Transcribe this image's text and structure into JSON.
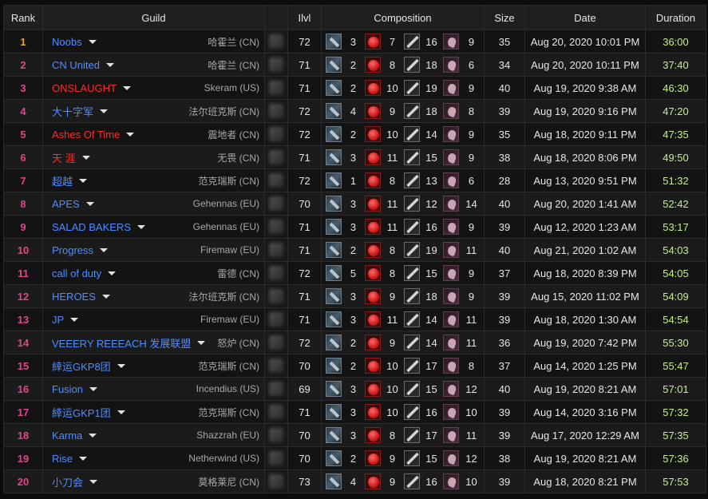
{
  "headers": {
    "rank": "Rank",
    "guild": "Guild",
    "ilvl": "Ilvl",
    "composition": "Composition",
    "size": "Size",
    "date": "Date",
    "duration": "Duration"
  },
  "colors": {
    "rank_gold": "#e8a436",
    "rank_pink": "#e0468a",
    "guild_alliance": "#4f8dff",
    "guild_horde": "#ff2a2a",
    "duration_green": "#c8ee8a"
  },
  "role_icons": {
    "tank": "tank-shield-icon",
    "healer": "healer-heart-icon",
    "melee": "melee-sword-icon",
    "ranged": "ranged-hand-icon"
  },
  "rows": [
    {
      "rank": "1",
      "guild": "Noobs",
      "faction": "alliance",
      "server": "哈霍兰 (CN)",
      "ilvl": "72",
      "tanks": "3",
      "healers": "7",
      "melee": "16",
      "ranged": "9",
      "size": "35",
      "date": "Aug 20, 2020 10:01 PM",
      "duration": "36:00"
    },
    {
      "rank": "2",
      "guild": "CN United",
      "faction": "alliance",
      "server": "哈霍兰 (CN)",
      "ilvl": "71",
      "tanks": "2",
      "healers": "8",
      "melee": "18",
      "ranged": "6",
      "size": "34",
      "date": "Aug 20, 2020 10:11 PM",
      "duration": "37:40"
    },
    {
      "rank": "3",
      "guild": "ONSLAUGHT",
      "faction": "horde",
      "server": "Skeram (US)",
      "ilvl": "71",
      "tanks": "2",
      "healers": "10",
      "melee": "19",
      "ranged": "9",
      "size": "40",
      "date": "Aug 19, 2020 9:38 AM",
      "duration": "46:30"
    },
    {
      "rank": "4",
      "guild": "大十字军",
      "faction": "alliance",
      "server": "法尔班克斯 (CN)",
      "ilvl": "72",
      "tanks": "4",
      "healers": "9",
      "melee": "18",
      "ranged": "8",
      "size": "39",
      "date": "Aug 19, 2020 9:16 PM",
      "duration": "47:20"
    },
    {
      "rank": "5",
      "guild": "Ashes Of Time",
      "faction": "horde",
      "server": "震地者 (CN)",
      "ilvl": "72",
      "tanks": "2",
      "healers": "10",
      "melee": "14",
      "ranged": "9",
      "size": "35",
      "date": "Aug 18, 2020 9:11 PM",
      "duration": "47:35"
    },
    {
      "rank": "6",
      "guild": "天 涯",
      "faction": "horde",
      "server": "无畏 (CN)",
      "ilvl": "71",
      "tanks": "3",
      "healers": "11",
      "melee": "15",
      "ranged": "9",
      "size": "38",
      "date": "Aug 18, 2020 8:06 PM",
      "duration": "49:50"
    },
    {
      "rank": "7",
      "guild": "超越",
      "faction": "alliance",
      "server": "范克瑞斯 (CN)",
      "ilvl": "72",
      "tanks": "1",
      "healers": "8",
      "melee": "13",
      "ranged": "6",
      "size": "28",
      "date": "Aug 13, 2020 9:51 PM",
      "duration": "51:32"
    },
    {
      "rank": "8",
      "guild": "APES",
      "faction": "alliance",
      "server": "Gehennas (EU)",
      "ilvl": "70",
      "tanks": "3",
      "healers": "11",
      "melee": "12",
      "ranged": "14",
      "size": "40",
      "date": "Aug 20, 2020 1:41 AM",
      "duration": "52:42"
    },
    {
      "rank": "9",
      "guild": "SALAD BAKERS",
      "faction": "alliance",
      "server": "Gehennas (EU)",
      "ilvl": "71",
      "tanks": "3",
      "healers": "11",
      "melee": "16",
      "ranged": "9",
      "size": "39",
      "date": "Aug 12, 2020 1:23 AM",
      "duration": "53:17"
    },
    {
      "rank": "10",
      "guild": "Progress",
      "faction": "alliance",
      "server": "Firemaw (EU)",
      "ilvl": "71",
      "tanks": "2",
      "healers": "8",
      "melee": "19",
      "ranged": "11",
      "size": "40",
      "date": "Aug 21, 2020 1:02 AM",
      "duration": "54:03"
    },
    {
      "rank": "11",
      "guild": "call of duty",
      "faction": "alliance",
      "server": "雷德 (CN)",
      "ilvl": "72",
      "tanks": "5",
      "healers": "8",
      "melee": "15",
      "ranged": "9",
      "size": "37",
      "date": "Aug 18, 2020 8:39 PM",
      "duration": "54:05"
    },
    {
      "rank": "12",
      "guild": "HEROES",
      "faction": "alliance",
      "server": "法尔班克斯 (CN)",
      "ilvl": "71",
      "tanks": "3",
      "healers": "9",
      "melee": "18",
      "ranged": "9",
      "size": "39",
      "date": "Aug 15, 2020 11:02 PM",
      "duration": "54:09"
    },
    {
      "rank": "13",
      "guild": "JP",
      "faction": "alliance",
      "server": "Firemaw (EU)",
      "ilvl": "71",
      "tanks": "3",
      "healers": "11",
      "melee": "14",
      "ranged": "11",
      "size": "39",
      "date": "Aug 18, 2020 1:30 AM",
      "duration": "54:54"
    },
    {
      "rank": "14",
      "guild": "VEEERY REEEACH 发展联盟",
      "faction": "alliance",
      "server": "怒炉 (CN)",
      "ilvl": "72",
      "tanks": "2",
      "healers": "9",
      "melee": "14",
      "ranged": "11",
      "size": "36",
      "date": "Aug 19, 2020 7:42 PM",
      "duration": "55:30"
    },
    {
      "rank": "15",
      "guild": "緈运GKP8团",
      "faction": "alliance",
      "server": "范克瑞斯 (CN)",
      "ilvl": "70",
      "tanks": "2",
      "healers": "10",
      "melee": "17",
      "ranged": "8",
      "size": "37",
      "date": "Aug 14, 2020 1:25 PM",
      "duration": "55:47"
    },
    {
      "rank": "16",
      "guild": "Fusion",
      "faction": "alliance",
      "server": "Incendius (US)",
      "ilvl": "69",
      "tanks": "3",
      "healers": "10",
      "melee": "15",
      "ranged": "12",
      "size": "40",
      "date": "Aug 19, 2020 8:21 AM",
      "duration": "57:01"
    },
    {
      "rank": "17",
      "guild": "緈运GKP1团",
      "faction": "alliance",
      "server": "范克瑞斯 (CN)",
      "ilvl": "71",
      "tanks": "3",
      "healers": "10",
      "melee": "16",
      "ranged": "10",
      "size": "39",
      "date": "Aug 14, 2020 3:16 PM",
      "duration": "57:32"
    },
    {
      "rank": "18",
      "guild": "Karma",
      "faction": "alliance",
      "server": "Shazzrah (EU)",
      "ilvl": "70",
      "tanks": "3",
      "healers": "8",
      "melee": "17",
      "ranged": "11",
      "size": "39",
      "date": "Aug 17, 2020 12:29 AM",
      "duration": "57:35"
    },
    {
      "rank": "19",
      "guild": "Rise",
      "faction": "alliance",
      "server": "Netherwind (US)",
      "ilvl": "70",
      "tanks": "2",
      "healers": "9",
      "melee": "15",
      "ranged": "12",
      "size": "38",
      "date": "Aug 19, 2020 8:21 AM",
      "duration": "57:36"
    },
    {
      "rank": "20",
      "guild": "小刀会",
      "faction": "alliance",
      "server": "莫格莱尼 (CN)",
      "ilvl": "73",
      "tanks": "4",
      "healers": "9",
      "melee": "16",
      "ranged": "10",
      "size": "39",
      "date": "Aug 18, 2020 8:21 PM",
      "duration": "57:53"
    }
  ]
}
